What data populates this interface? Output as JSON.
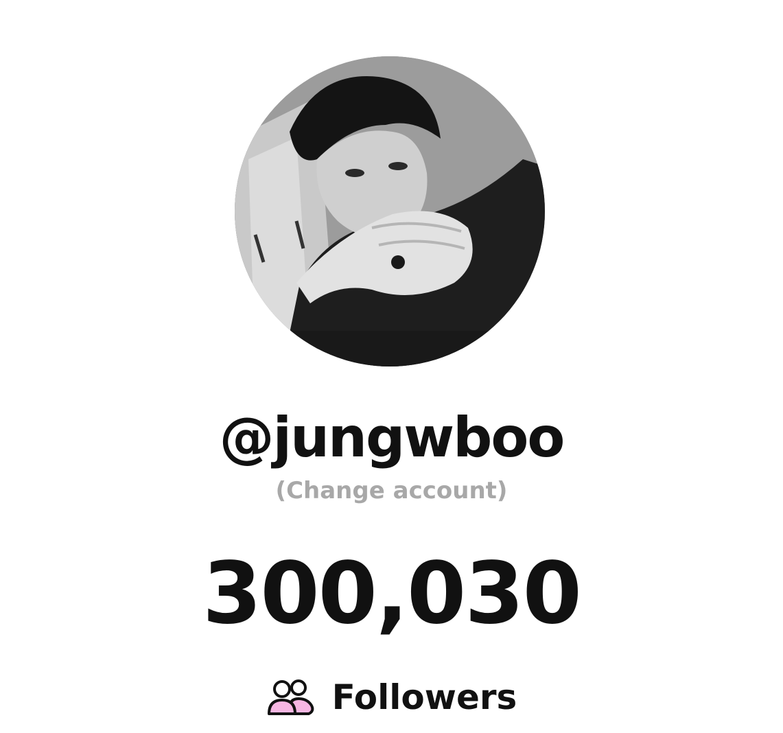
{
  "profile": {
    "username": "@jungwboo",
    "change_account_label": "(Change account)",
    "avatar_icon": "profile-photo"
  },
  "stats": {
    "follower_count": "300,030",
    "followers_label": "Followers",
    "followers_icon": "users-icon"
  },
  "colors": {
    "text": "#111111",
    "muted": "#a8a8a8",
    "accent_pink": "#f6b6e2"
  }
}
